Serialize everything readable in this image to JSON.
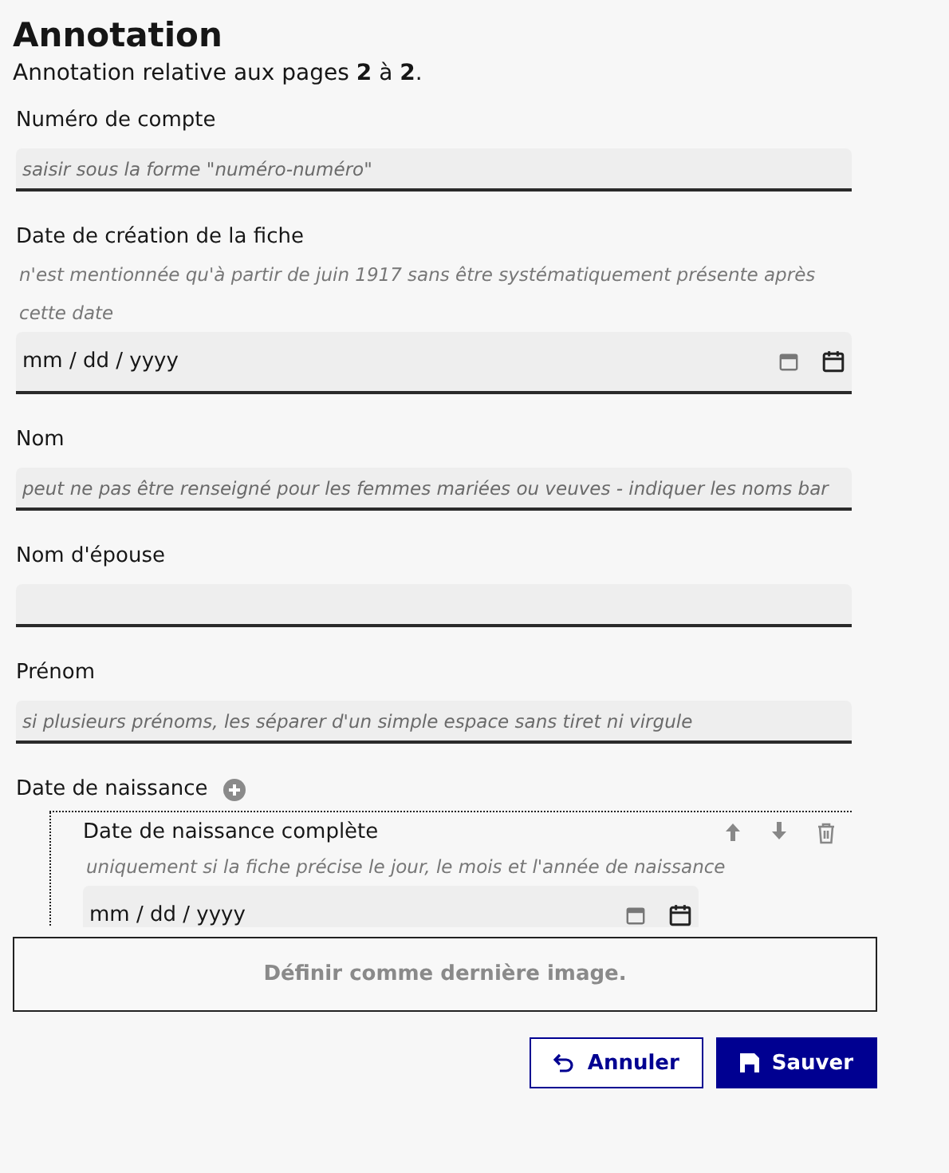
{
  "title": "Annotation",
  "subtitle": "Annotation relative aux pages **2** à **2**.",
  "fields": [
    {
      "kind": "text",
      "label": "Numéro de compte",
      "placeholder": "saisir sous la forme \"numéro-numéro\""
    },
    {
      "kind": "date",
      "label": "Date de création de la fiche",
      "hint": "n'est mentionnée qu'à partir de juin 1917 sans être systématiquement présente après cette date",
      "placeholder": "mm / dd / yyyy"
    },
    {
      "kind": "text",
      "label": "Nom",
      "placeholder": "peut ne pas être renseigné pour les femmes mariées ou veuves - indiquer les noms bar"
    },
    {
      "kind": "text",
      "label": "Nom d'épouse"
    },
    {
      "kind": "text",
      "label": "Prénom",
      "placeholder": "si plusieurs prénoms, les séparer d'un simple espace sans tiret ni virgule"
    }
  ],
  "group": {
    "label": "Date de naissance",
    "entries": [
      {
        "label": "Date de naissance complète",
        "hint": "uniquement si la fiche précise le jour, le mois et l'année de naissance",
        "placeholder": "mm / dd / yyyy"
      }
    ]
  },
  "set_last_image": "Définir comme dernière image.",
  "buttons": [
    {
      "kind": "secondary",
      "label": "Annuler"
    },
    {
      "kind": "primary",
      "label": "Sauver"
    }
  ]
}
